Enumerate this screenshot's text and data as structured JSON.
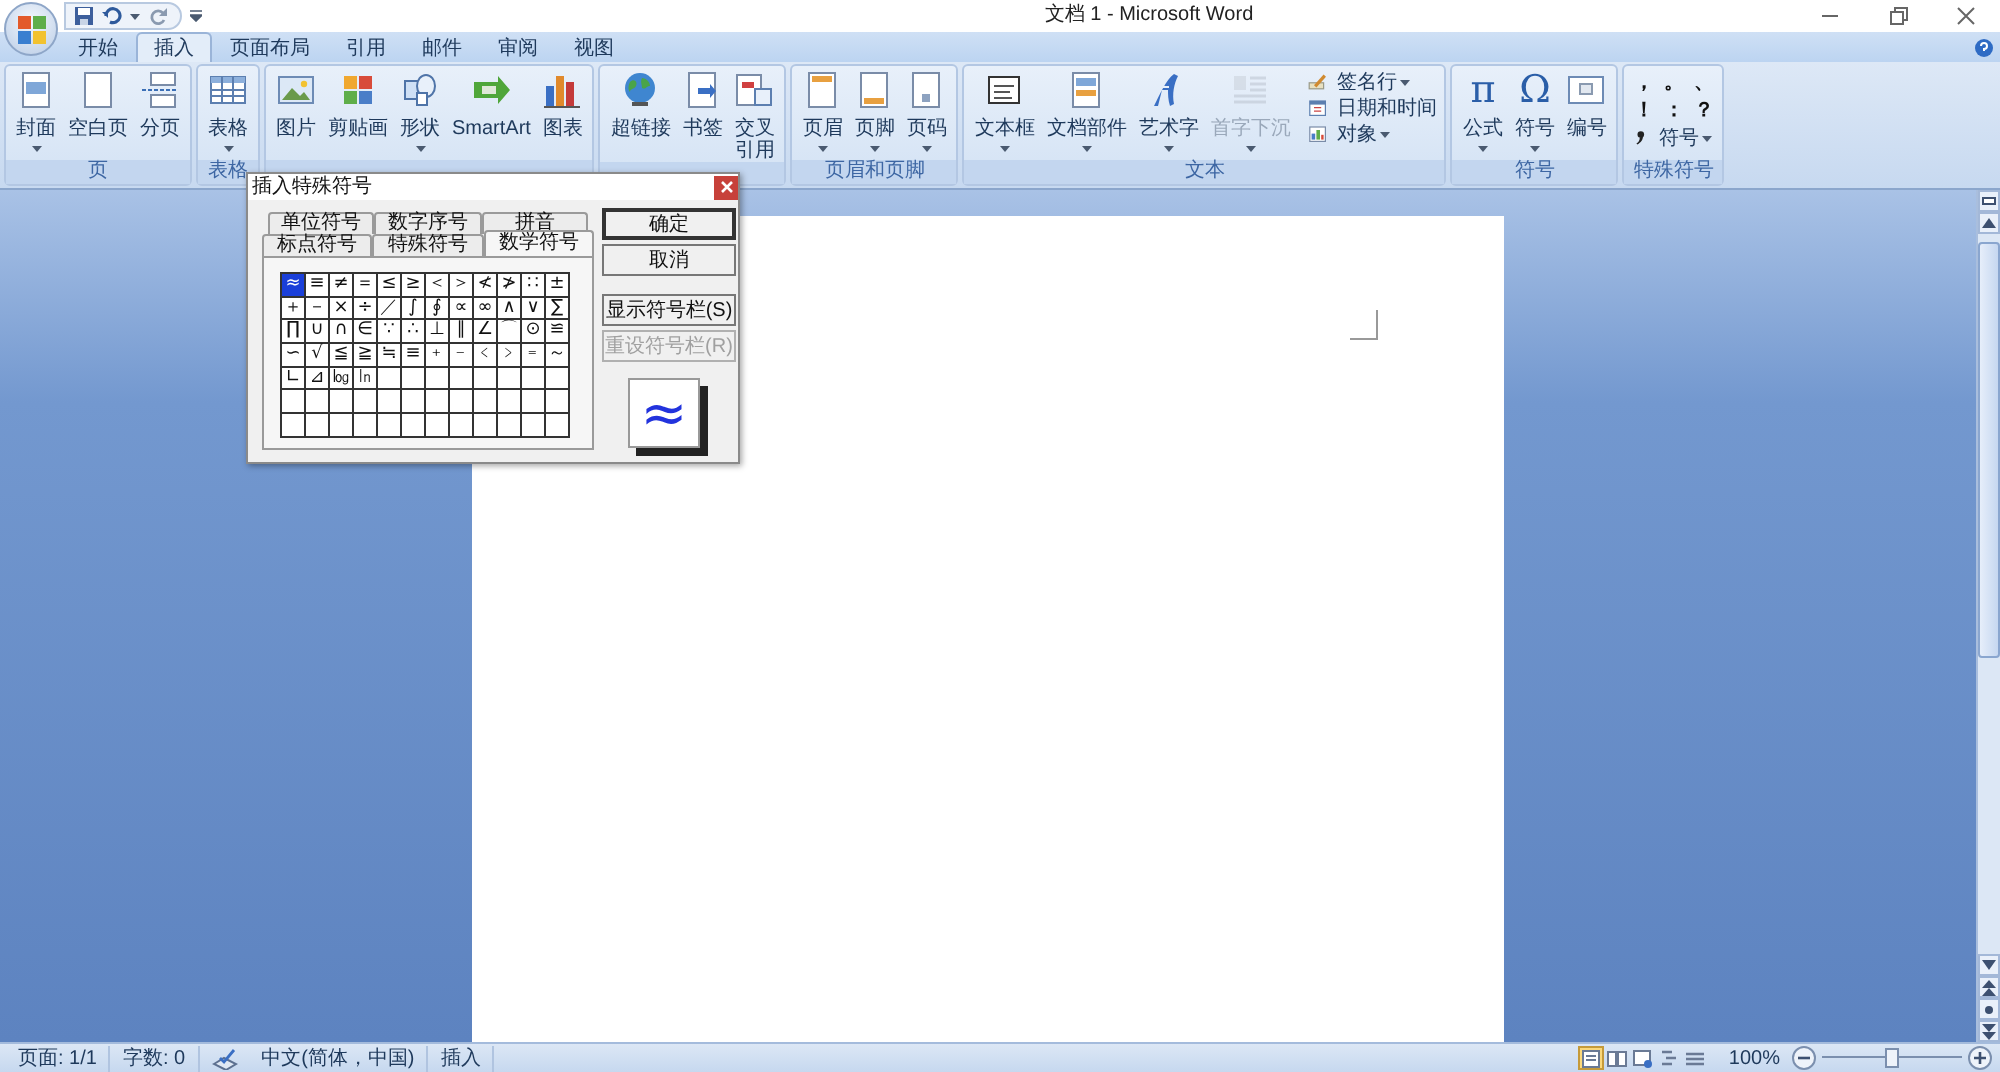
{
  "window": {
    "title": "文档 1 - Microsoft Word"
  },
  "ribbon_tabs": [
    {
      "label": "开始",
      "selected": false
    },
    {
      "label": "插入",
      "selected": true
    },
    {
      "label": "页面布局",
      "selected": false
    },
    {
      "label": "引用",
      "selected": false
    },
    {
      "label": "邮件",
      "selected": false
    },
    {
      "label": "审阅",
      "selected": false
    },
    {
      "label": "视图",
      "selected": false
    }
  ],
  "ribbon_groups": [
    {
      "label": "页",
      "items": [
        {
          "kind": "large",
          "label": "封面",
          "dropdown": true,
          "disabled": false
        },
        {
          "kind": "large",
          "label": "空白页",
          "dropdown": false,
          "disabled": false
        },
        {
          "kind": "large",
          "label": "分页",
          "dropdown": false,
          "disabled": false
        }
      ]
    },
    {
      "label": "表格",
      "items": [
        {
          "kind": "large",
          "label": "表格",
          "dropdown": true,
          "disabled": false
        }
      ]
    },
    {
      "items": [
        {
          "kind": "large",
          "label": "图片",
          "dropdown": false,
          "disabled": false
        },
        {
          "kind": "large",
          "label": "剪贴画",
          "dropdown": false,
          "disabled": false
        },
        {
          "kind": "large",
          "label": "形状",
          "dropdown": true,
          "disabled": false
        },
        {
          "kind": "large",
          "label": "SmartArt",
          "dropdown": false,
          "disabled": false
        },
        {
          "kind": "large",
          "label": "图表",
          "dropdown": false,
          "disabled": false
        }
      ]
    },
    {
      "items": [
        {
          "kind": "large",
          "label": "超链接",
          "dropdown": false,
          "disabled": false
        },
        {
          "kind": "large",
          "label": "书签",
          "dropdown": false,
          "disabled": false
        },
        {
          "kind": "large",
          "label_lines": [
            "交叉",
            "引用"
          ],
          "dropdown": false,
          "disabled": false
        }
      ]
    },
    {
      "label": "页眉和页脚",
      "items": [
        {
          "kind": "large",
          "label": "页眉",
          "dropdown": true,
          "disabled": false
        },
        {
          "kind": "large",
          "label": "页脚",
          "dropdown": true,
          "disabled": false
        },
        {
          "kind": "large",
          "label": "页码",
          "dropdown": true,
          "disabled": false
        }
      ]
    },
    {
      "label": "文本",
      "items": [
        {
          "kind": "large",
          "label": "文本框",
          "dropdown": true,
          "disabled": false
        },
        {
          "kind": "large",
          "label": "文档部件",
          "dropdown": true,
          "disabled": false
        },
        {
          "kind": "large",
          "label": "艺术字",
          "dropdown": true,
          "disabled": false
        },
        {
          "kind": "large",
          "label": "首字下沉",
          "dropdown": true,
          "disabled": true
        },
        {
          "kind": "stack",
          "items": [
            {
              "label": "签名行",
              "dropdown": true,
              "disabled": false
            },
            {
              "label": "日期和时间",
              "dropdown": false,
              "disabled": false
            },
            {
              "label": "对象",
              "dropdown": true,
              "disabled": false
            }
          ]
        }
      ]
    },
    {
      "label": "符号",
      "items": [
        {
          "kind": "large",
          "glyph": "π",
          "label": "公式",
          "dropdown": true,
          "disabled": false
        },
        {
          "kind": "large",
          "glyph": "Ω",
          "label": "符号",
          "dropdown": true,
          "disabled": false
        },
        {
          "kind": "large",
          "label": "编号",
          "dropdown": false,
          "disabled": false
        }
      ]
    },
    {
      "label": "特殊符号",
      "items": [
        {
          "kind": "marks",
          "marks": [
            "，",
            "。",
            "、",
            "！",
            "：",
            "？"
          ]
        },
        {
          "kind": "small",
          "label": "符号",
          "dropdown": true,
          "disabled": false
        }
      ]
    }
  ],
  "dialog": {
    "title": "插入特殊符号",
    "tab_rows": [
      [
        {
          "label": "单位符号",
          "selected": false
        },
        {
          "label": "数字序号",
          "selected": false
        },
        {
          "label": "拼音",
          "selected": false
        }
      ],
      [
        {
          "label": "标点符号",
          "selected": false
        },
        {
          "label": "特殊符号",
          "selected": false
        },
        {
          "label": "数学符号",
          "selected": true
        }
      ]
    ],
    "symbols": [
      {
        "char": "≈",
        "selected": true
      },
      {
        "char": "≡",
        "selected": false
      },
      {
        "char": "≠",
        "selected": false
      },
      {
        "char": "＝",
        "selected": false
      },
      {
        "char": "≤",
        "selected": false
      },
      {
        "char": "≥",
        "selected": false
      },
      {
        "char": "＜",
        "selected": false
      },
      {
        "char": "＞",
        "selected": false
      },
      {
        "char": "≮",
        "selected": false
      },
      {
        "char": "≯",
        "selected": false
      },
      {
        "char": "∷",
        "selected": false
      },
      {
        "char": "±",
        "selected": false
      },
      {
        "char": "＋",
        "selected": false
      },
      {
        "char": "－",
        "selected": false
      },
      {
        "char": "×",
        "selected": false
      },
      {
        "char": "÷",
        "selected": false
      },
      {
        "char": "／",
        "selected": false
      },
      {
        "char": "∫",
        "selected": false
      },
      {
        "char": "∮",
        "selected": false
      },
      {
        "char": "∝",
        "selected": false
      },
      {
        "char": "∞",
        "selected": false
      },
      {
        "char": "∧",
        "selected": false
      },
      {
        "char": "∨",
        "selected": false
      },
      {
        "char": "∑",
        "selected": false
      },
      {
        "char": "∏",
        "selected": false
      },
      {
        "char": "∪",
        "selected": false
      },
      {
        "char": "∩",
        "selected": false
      },
      {
        "char": "∈",
        "selected": false
      },
      {
        "char": "∵",
        "selected": false
      },
      {
        "char": "∴",
        "selected": false
      },
      {
        "char": "⊥",
        "selected": false
      },
      {
        "char": "∥",
        "selected": false
      },
      {
        "char": "∠",
        "selected": false
      },
      {
        "char": "⌒",
        "selected": false
      },
      {
        "char": "⊙",
        "selected": false
      },
      {
        "char": "≌",
        "selected": false
      },
      {
        "char": "∽",
        "selected": false
      },
      {
        "char": "√",
        "selected": false
      },
      {
        "char": "≦",
        "selected": false
      },
      {
        "char": "≧",
        "selected": false
      },
      {
        "char": "≒",
        "selected": false
      },
      {
        "char": "≡",
        "selected": false
      },
      {
        "char": "﹢",
        "selected": false
      },
      {
        "char": "﹣",
        "selected": false
      },
      {
        "char": "﹤",
        "selected": false
      },
      {
        "char": "﹥",
        "selected": false
      },
      {
        "char": "﹦",
        "selected": false
      },
      {
        "char": "～",
        "selected": false
      },
      {
        "char": "∟",
        "selected": false
      },
      {
        "char": "⊿",
        "selected": false
      },
      {
        "char": "㏒",
        "selected": false
      },
      {
        "char": "㏑",
        "selected": false
      }
    ],
    "buttons": [
      {
        "label": "确定",
        "default": true,
        "disabled": false
      },
      {
        "label": "取消",
        "default": false,
        "disabled": false
      },
      {
        "label": "显示符号栏(S)",
        "default": false,
        "disabled": false
      },
      {
        "label": "重设符号栏(R)",
        "default": false,
        "disabled": true
      }
    ],
    "preview": "≈"
  },
  "status_bar": {
    "items": [
      {
        "kind": "text",
        "label": "页面: 1/1"
      },
      {
        "kind": "text",
        "label": "字数: 0"
      },
      {
        "kind": "proofing"
      },
      {
        "kind": "text",
        "label": "中文(简体，中国)"
      },
      {
        "kind": "text",
        "label": "插入"
      }
    ],
    "views": [
      {
        "selected": true
      },
      {
        "selected": false
      },
      {
        "selected": false
      },
      {
        "selected": false
      },
      {
        "selected": false
      }
    ],
    "zoom": {
      "reading": "100%",
      "level": 0.5
    }
  }
}
